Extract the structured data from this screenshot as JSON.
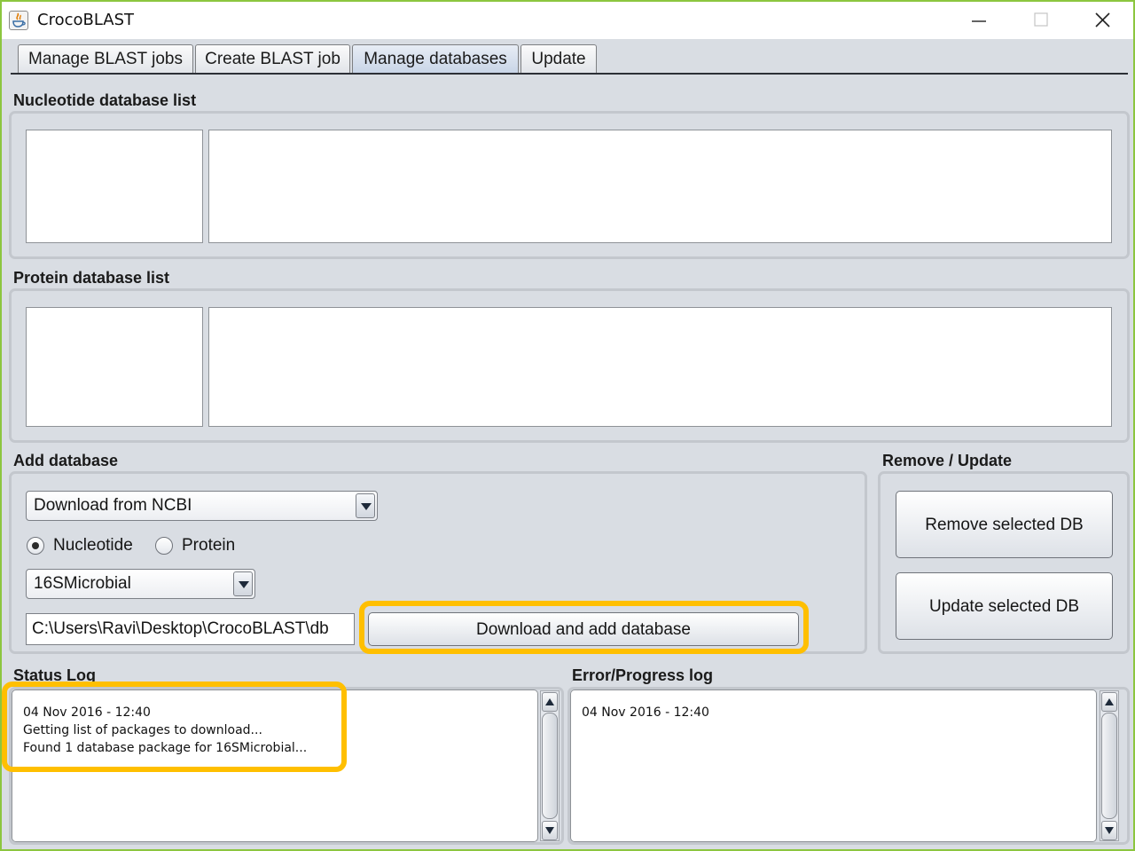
{
  "window": {
    "title": "CrocoBLAST",
    "border_color": "#8cc63f"
  },
  "tabs": [
    {
      "label": "Manage BLAST jobs",
      "active": false
    },
    {
      "label": "Create BLAST job",
      "active": false
    },
    {
      "label": "Manage databases",
      "active": true
    },
    {
      "label": "Update",
      "active": false
    }
  ],
  "nucleotide_section": {
    "label": "Nucleotide database list"
  },
  "protein_section": {
    "label": "Protein database list"
  },
  "add_database": {
    "label": "Add database",
    "source_selected": "Download from NCBI",
    "radio_nucleotide": "Nucleotide",
    "radio_protein": "Protein",
    "selected_type": "Nucleotide",
    "database_selected": "16SMicrobial",
    "path_value": "C:\\Users\\Ravi\\Desktop\\CrocoBLAST\\db",
    "download_button": "Download and add database"
  },
  "remove_update": {
    "label": "Remove / Update",
    "remove_button": "Remove selected DB",
    "update_button": "Update selected DB"
  },
  "status_log": {
    "label": "Status Log",
    "lines": [
      "04 Nov 2016 - 12:40",
      "Getting list of packages to download...",
      "Found 1 database package for 16SMicrobial..."
    ]
  },
  "error_log": {
    "label": "Error/Progress log",
    "lines": [
      "04 Nov 2016 - 12:40"
    ]
  },
  "colors": {
    "highlight": "#ffbf00",
    "window_bg": "#d9dde3"
  },
  "icons": [
    "java-app-icon",
    "minimize-icon",
    "maximize-icon",
    "close-icon",
    "chevron-down-icon",
    "scroll-up-icon",
    "scroll-down-icon"
  ]
}
